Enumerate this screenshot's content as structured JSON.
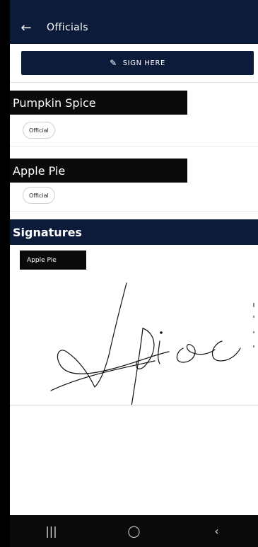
{
  "header": {
    "back_icon": "arrow-left-icon",
    "title": "Officials"
  },
  "sign_here": {
    "icon": "pen-icon",
    "label": "SIGN HERE"
  },
  "officials": [
    {
      "name": "Pumpkin Spice",
      "role": "Official"
    },
    {
      "name": "Apple Pie",
      "role": "Official"
    }
  ],
  "signatures": {
    "title": "Signatures",
    "items": [
      {
        "name": "Apple Pie",
        "signature_text": "Apie"
      }
    ]
  },
  "navbar": {
    "recent_icon": "recent-apps-icon",
    "home_icon": "home-icon",
    "back_icon": "back-chevron-icon"
  },
  "colors": {
    "primary": "#0d1b3a",
    "black": "#0a0a0a"
  }
}
